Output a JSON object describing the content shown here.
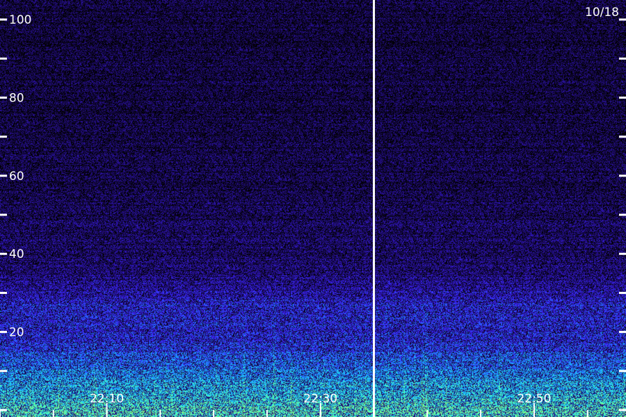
{
  "chart_data": {
    "type": "heatmap",
    "title": "",
    "xlabel": "",
    "ylabel": "",
    "date_label": "10/18",
    "x_axis": {
      "tick_labels": [
        "22:10",
        "22:30",
        "22:50"
      ],
      "label_minutes": [
        10,
        30,
        50
      ],
      "minor_tick_minutes": [
        0,
        5,
        10,
        15,
        20,
        25,
        30,
        35,
        40,
        45,
        50,
        55
      ],
      "range_minutes": [
        0,
        58.6
      ]
    },
    "y_axis": {
      "tick_labels": [
        "20",
        "40",
        "60",
        "80",
        "100"
      ],
      "labeled_ticks": [
        20,
        40,
        60,
        80,
        100
      ],
      "all_ticks": [
        0,
        10,
        20,
        30,
        40,
        50,
        60,
        70,
        80,
        90,
        100
      ],
      "ylim": [
        0,
        105
      ]
    },
    "marker_line_minutes": 35,
    "colormap": [
      "#000000",
      "#1a0a55",
      "#2b12a8",
      "#3c28ff",
      "#1a8cff",
      "#20e8f0",
      "#80ff80"
    ],
    "intensity_profile": {
      "y": [
        0,
        5,
        10,
        15,
        20,
        25,
        30,
        35,
        40,
        50,
        60,
        80,
        100
      ],
      "level": [
        0.85,
        0.75,
        0.62,
        0.52,
        0.42,
        0.45,
        0.35,
        0.26,
        0.22,
        0.18,
        0.15,
        0.13,
        0.12
      ]
    }
  }
}
